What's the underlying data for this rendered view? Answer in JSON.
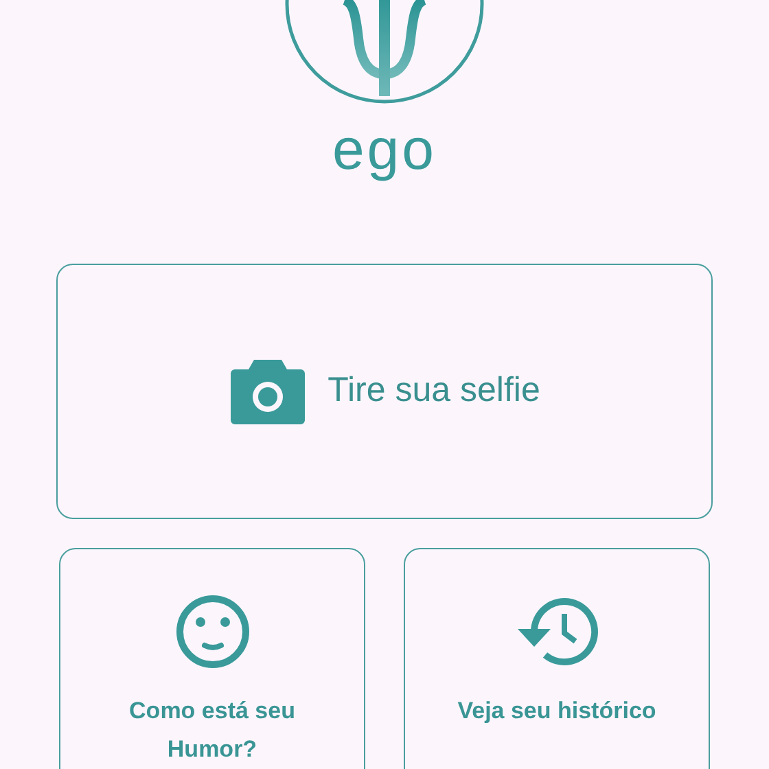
{
  "logo": {
    "wordmark": "ego"
  },
  "main_action": {
    "kind": "camera",
    "label": "Tire sua selfie"
  },
  "actions": [
    {
      "kind": "mood",
      "label": "Como está seu Humor?"
    },
    {
      "kind": "history",
      "label": "Veja seu histórico"
    }
  ]
}
